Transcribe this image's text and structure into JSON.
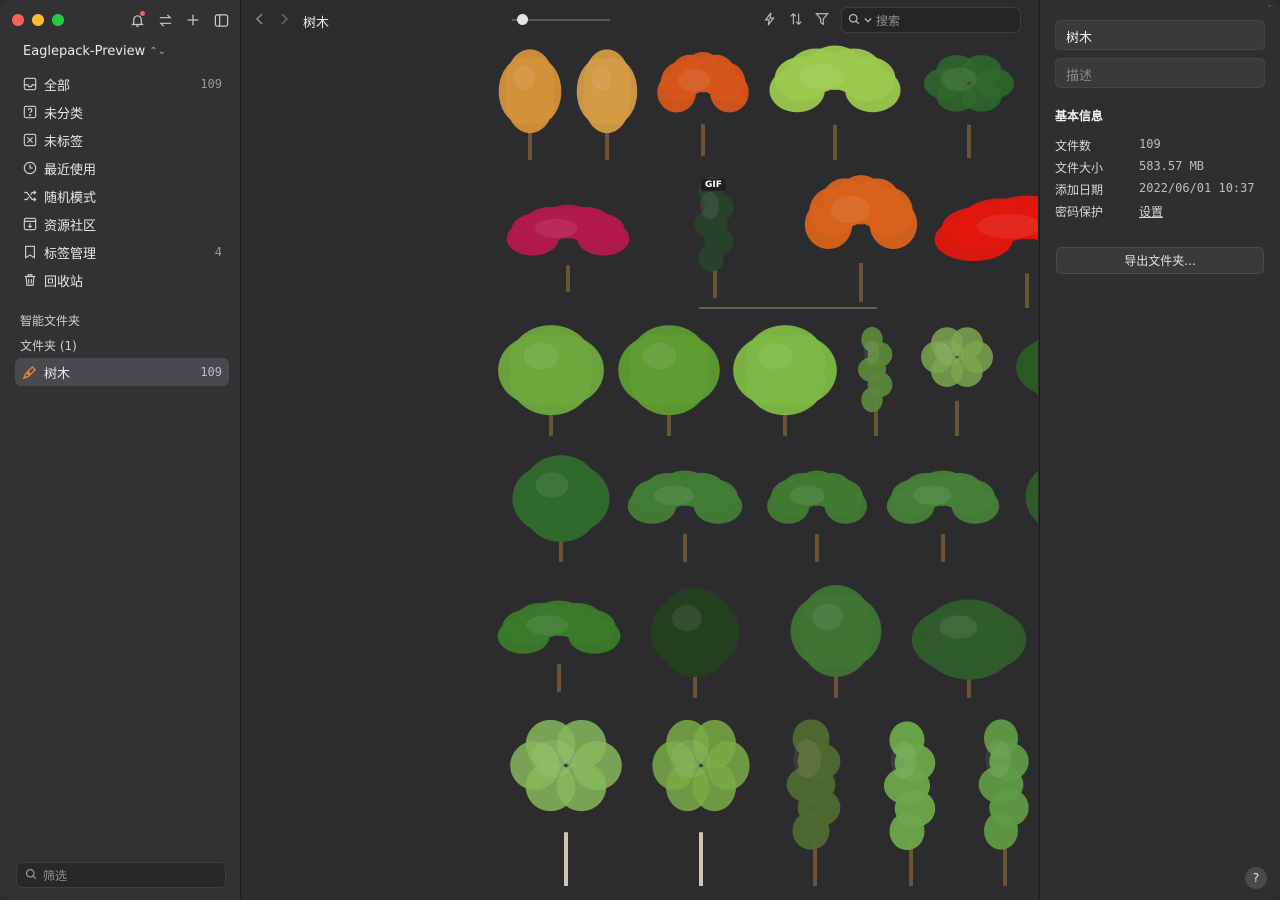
{
  "sidebar": {
    "library_name": "Eaglepack-Preview",
    "items": [
      {
        "label": "全部",
        "count": "109",
        "icon": "inbox-icon"
      },
      {
        "label": "未分类",
        "count": "",
        "icon": "question-box-icon"
      },
      {
        "label": "未标签",
        "count": "",
        "icon": "tag-off-icon"
      },
      {
        "label": "最近使用",
        "count": "",
        "icon": "clock-icon"
      },
      {
        "label": "随机模式",
        "count": "",
        "icon": "shuffle-icon"
      },
      {
        "label": "资源社区",
        "count": "",
        "icon": "download-box-icon"
      },
      {
        "label": "标签管理",
        "count": "4",
        "icon": "tag-icon"
      },
      {
        "label": "回收站",
        "count": "",
        "icon": "trash-icon"
      }
    ],
    "smart_folders_label": "智能文件夹",
    "folders_label": "文件夹 (1)",
    "folder": {
      "label": "树木",
      "count": "109"
    },
    "filter_placeholder": "筛选"
  },
  "toolbar": {
    "breadcrumb": "树木",
    "search_placeholder": "搜索",
    "zoom_level": 0.1
  },
  "grid": {
    "gif_badge": "GIF"
  },
  "inspector": {
    "title": "树木",
    "description_placeholder": "描述",
    "basic_info_label": "基本信息",
    "rows": [
      {
        "key": "文件数",
        "value": "109"
      },
      {
        "key": "文件大小",
        "value": "583.57 MB"
      },
      {
        "key": "添加日期",
        "value": "2022/06/01 10:37"
      },
      {
        "key": "密码保护",
        "value": "设置"
      }
    ],
    "export_label": "导出文件夹...",
    "help_label": "?"
  },
  "colors": {
    "accent_orange": "#e8892e",
    "selected_row": "#4a4a4e"
  }
}
